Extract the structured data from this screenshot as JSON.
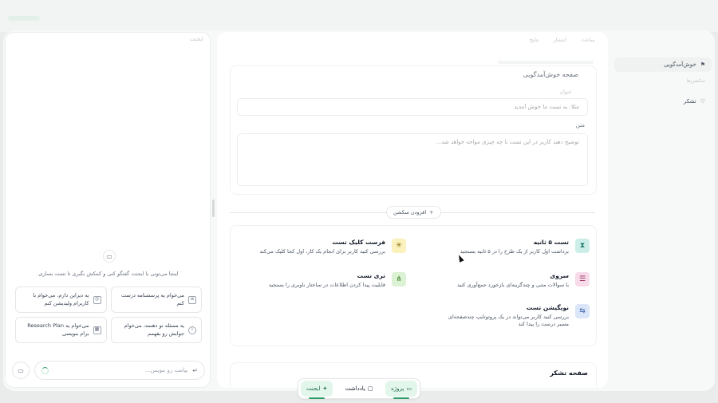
{
  "chat": {
    "title": "ایجنت",
    "hint": "اینجا می‌تونی با ایجنت گفتگو کنی و کمکش بگیری تا تست بسازی.",
    "suggestions": [
      {
        "label": "می‌خوام یه پرسشنامه درست کنم",
        "icon": "clipboard-icon"
      },
      {
        "label": "یه دیزاین دارم، می‌خوام با کاربرام ولیدیشن کنم",
        "icon": "target-icon"
      },
      {
        "label": "یه مسئله تو ذهنمه، می‌خوام جوابش رو بفهمم",
        "icon": "info-icon"
      },
      {
        "label": "می‌خوام یه Research Plan برام بنویسی",
        "icon": "map-icon"
      }
    ],
    "input_placeholder": "پیامت رو بنویس..."
  },
  "main": {
    "tabs": [
      "ساخت",
      "انتشار",
      "نتایج"
    ],
    "welcome": {
      "page_title": "صفحه خوش‌آمدگویی",
      "title_label": "عنوان",
      "title_placeholder": "مثلا: به تست ما خوش آمدید",
      "body_label": "متن",
      "body_placeholder": "توضیح دهید کاربر در این تست با چه چیزی مواجه خواهد شد..."
    },
    "add_section": "افزودن سکشن",
    "test_types": [
      {
        "name": "تست ۵ ثانیه",
        "desc": "برداشت اول کاربر از یک طرح را در ۵ ثانیه بسنجید",
        "color": "#cdeee8",
        "glyph": "⧗"
      },
      {
        "name": "فرست کلیک تست",
        "desc": "بررسی کنید کاربر برای انجام یک کار، اول کجا کلیک می‌کند",
        "color": "#fbf1bd",
        "glyph": "✳"
      },
      {
        "name": "سروی",
        "desc": "با سوالات متنی و چندگزینه‌ای بازخورد جمع‌آوری کنید",
        "color": "#f7dbe9",
        "glyph": "☰"
      },
      {
        "name": "تری تست",
        "desc": "قابلیت پیدا کردن اطلاعات در ساختار ناوبری را بسنجید",
        "color": "#dcf2d4",
        "glyph": "⋔"
      },
      {
        "name": "نویگیشن تست",
        "desc": "بررسی کنید کاربر می‌تواند در یک پروتوتایپ چندصفحه‌ای مسیر درست را پیدا کند",
        "color": "#dbe6f8",
        "glyph": "⇆"
      }
    ],
    "thanks_title": "صفحه تشکر"
  },
  "sidebar": {
    "welcome": "خوش‌آمدگویی",
    "sections_label": "سکشن‌ها",
    "thanks": "تشکر"
  },
  "nav": {
    "project": "پروژه",
    "notes": "یادداشت",
    "agent": "ایجنت"
  },
  "colors": {
    "accent_green": "#2e9e68",
    "accent_green_bg": "#e3f6ec"
  }
}
